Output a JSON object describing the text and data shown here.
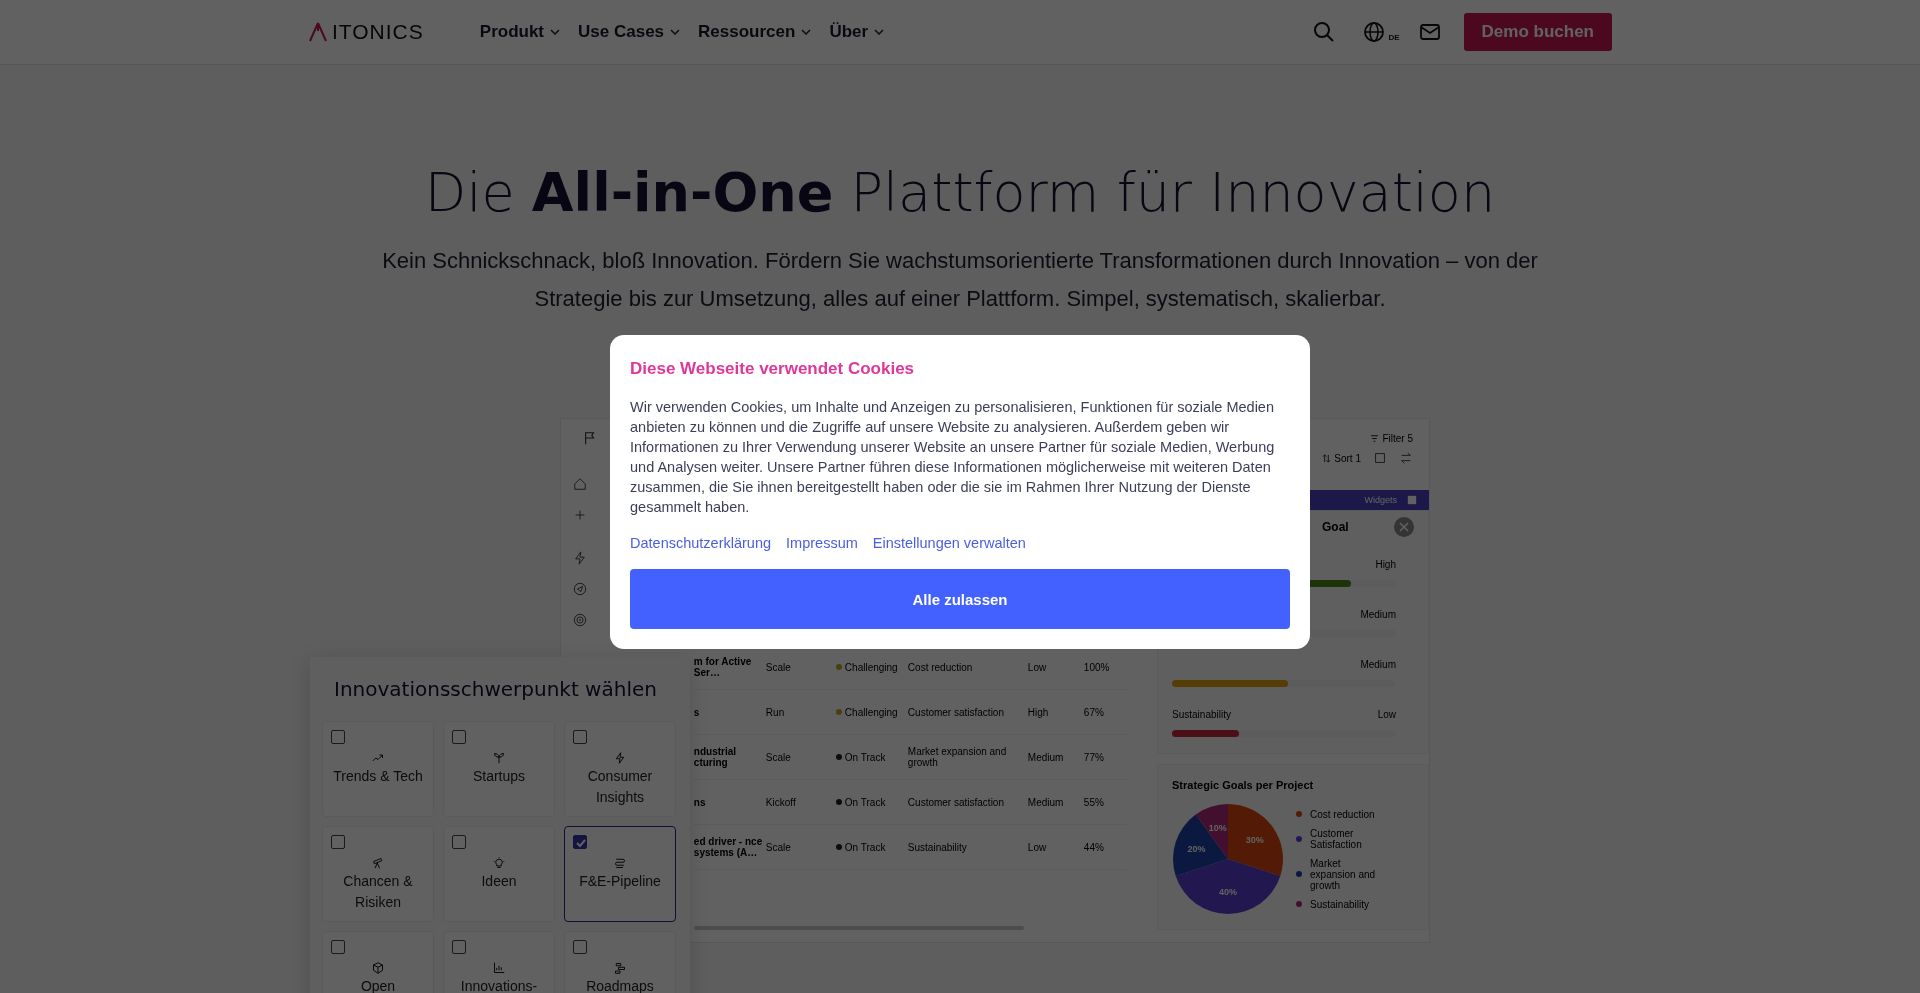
{
  "header": {
    "logo": "ITONICS",
    "nav": [
      {
        "label": "Produkt"
      },
      {
        "label": "Use Cases"
      },
      {
        "label": "Ressourcen"
      },
      {
        "label": "Über"
      }
    ],
    "language": "DE",
    "cta": "Demo buchen"
  },
  "hero": {
    "title": "Die **All-in-One** Plattform für Innovation",
    "subtitle": "Kein Schnickschnack, bloß Innovation. Fördern Sie wachstumsorientierte Transformationen durch Innovation – von der Strategie bis zur Umsetzung, alles auf einer Plattform. Simpel, systematisch, skalierbar."
  },
  "dashboard": {
    "filter": {
      "label": "Filter",
      "count": "5"
    },
    "sort": {
      "label": "Sort",
      "count": "1"
    },
    "table_rows": [
      {
        "name": "m for Active Ser…",
        "phase": "Scale",
        "status": "Challenging",
        "color": "#4c3e0f",
        "goal": "Cost reduction",
        "priority": "Low",
        "progress": "100%"
      },
      {
        "name": "s",
        "phase": "Run",
        "status": "Challenging",
        "color": "#4c3e0f",
        "goal": "Customer satisfaction",
        "priority": "High",
        "progress": "67%"
      },
      {
        "name": "ndustrial cturing",
        "phase": "Scale",
        "status": "On Track",
        "color": "#0d0d0d",
        "goal": "Market expansion and growth",
        "priority": "Medium",
        "progress": "77%"
      },
      {
        "name": "ns",
        "phase": "Kickoff",
        "status": "On Track",
        "color": "#0d0d0d",
        "goal": "Customer satisfaction",
        "priority": "Medium",
        "progress": "55%"
      },
      {
        "name": "ed driver - nce systems (A…",
        "phase": "Scale",
        "status": "On Track",
        "color": "#0d0d0d",
        "goal": "Sustainability",
        "priority": "Low",
        "progress": "44%"
      }
    ],
    "widgets": {
      "label": "Widgets",
      "goal_title": "Goal",
      "goals": [
        {
          "rating": "High",
          "level": 0.8,
          "color": "#1d340b"
        },
        {
          "rating": "Medium"
        },
        {
          "rating": "Medium",
          "level": 0.52,
          "color": "#553d06"
        },
        {
          "name": "Sustainability",
          "rating": "Low",
          "level": 0.3,
          "color": "#4a1016"
        }
      ],
      "chart_data": {
        "type": "pie",
        "title": "Strategic Goals per Project",
        "categories": [
          "Cost reduction",
          "Customer Satisfaction",
          "Market expansion and growth",
          "Sustainability"
        ],
        "values": [
          30,
          40,
          20,
          10
        ],
        "colors": [
          "#d9480f",
          "#5b3fd0",
          "#1e3fa8",
          "#b0287a"
        ],
        "value_labels": [
          "30%",
          "40%",
          "20%",
          "10%"
        ],
        "legend": "right"
      }
    }
  },
  "focus_panel": {
    "title": "Innovationsschwerpunkt wählen",
    "options": [
      {
        "label": "Trends & Tech",
        "kind": "trend",
        "checked": false
      },
      {
        "label": "Startups",
        "kind": "sprout",
        "checked": false
      },
      {
        "label": "Consumer Insights",
        "kind": "bolt",
        "checked": false
      },
      {
        "label": "Chancen & Risiken",
        "kind": "telescope",
        "checked": false
      },
      {
        "label": "Ideen",
        "kind": "bulb",
        "checked": false
      },
      {
        "label": "F&E-Pipeline",
        "kind": "pipeline",
        "checked": true
      },
      {
        "label": "Open",
        "kind": "box",
        "checked": false
      },
      {
        "label": "Innovations-",
        "kind": "chart",
        "checked": false
      },
      {
        "label": "Roadmaps",
        "kind": "roadmap",
        "checked": false
      }
    ]
  },
  "cookie_dialog": {
    "title": "Diese Webseite verwendet Cookies",
    "text": "Wir verwenden Cookies, um Inhalte und Anzeigen zu personalisieren, Funktionen für soziale Medien anbieten zu können und die Zugriffe auf unsere Website zu analysieren. Außerdem geben wir Informationen zu Ihrer Verwendung unserer Website an unsere Partner für soziale Medien, Werbung und Analysen weiter. Unsere Partner führen diese Informationen möglicherweise mit weiteren Daten zusammen, die Sie ihnen bereitgestellt haben oder die sie im Rahmen Ihrer Nutzung der Dienste gesammelt haben.",
    "links": [
      "Datenschutzerklärung",
      "Impressum",
      "Einstellungen verwalten"
    ],
    "button": "Alle zulassen"
  }
}
